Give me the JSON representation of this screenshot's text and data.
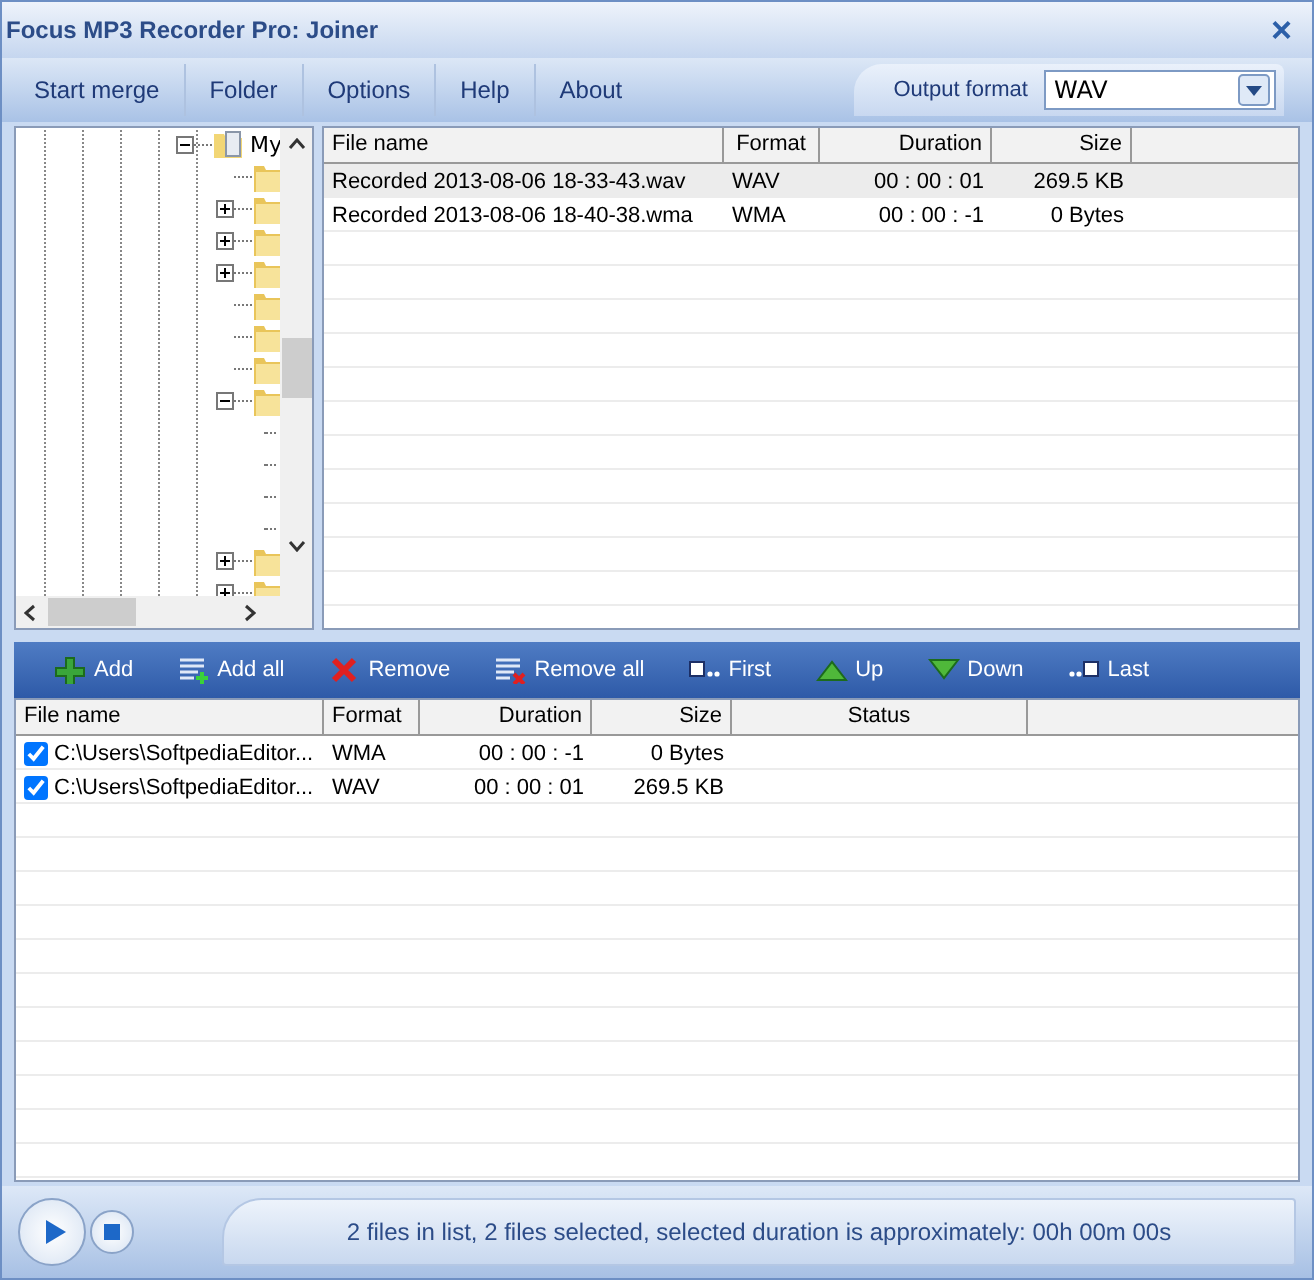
{
  "window": {
    "title": "Focus MP3 Recorder Pro: Joiner",
    "close": "×"
  },
  "menu": [
    {
      "label": "Start merge"
    },
    {
      "label": "Folder"
    },
    {
      "label": "Options"
    },
    {
      "label": "Help"
    },
    {
      "label": "About"
    }
  ],
  "output_format": {
    "label": "Output format",
    "value": "WAV"
  },
  "tree": {
    "label": "My",
    "expanded": true,
    "children": [
      {
        "kind": "leaf"
      },
      {
        "kind": "folder",
        "expanded": false
      },
      {
        "kind": "folder",
        "expanded": false
      },
      {
        "kind": "folder",
        "expanded": false
      },
      {
        "kind": "leaf"
      },
      {
        "kind": "leaf"
      },
      {
        "kind": "leaf"
      },
      {
        "kind": "folder",
        "expanded": true,
        "children": [
          {
            "kind": "stub"
          },
          {
            "kind": "stub"
          },
          {
            "kind": "stub"
          },
          {
            "kind": "stub"
          }
        ]
      },
      {
        "kind": "folder",
        "expanded": false
      },
      {
        "kind": "folder",
        "expanded": false
      }
    ]
  },
  "source_table": {
    "columns": [
      "File name",
      "Format",
      "Duration",
      "Size"
    ],
    "rows": [
      {
        "selected": true,
        "cells": [
          "Recorded 2013-08-06 18-33-43.wav",
          "WAV",
          "00 : 00 : 01",
          "269.5 KB"
        ]
      },
      {
        "selected": false,
        "cells": [
          "Recorded 2013-08-06 18-40-38.wma",
          "WMA",
          "00 : 00 : -1",
          "0 Bytes"
        ]
      }
    ]
  },
  "toolbar": [
    {
      "kind": "add",
      "label": "Add"
    },
    {
      "kind": "add_all",
      "label": "Add all"
    },
    {
      "kind": "remove",
      "label": "Remove"
    },
    {
      "kind": "remove_all",
      "label": "Remove all"
    },
    {
      "kind": "first",
      "label": "First"
    },
    {
      "kind": "up",
      "label": "Up"
    },
    {
      "kind": "down",
      "label": "Down"
    },
    {
      "kind": "last",
      "label": "Last"
    }
  ],
  "join_table": {
    "columns": [
      "File name",
      "Format",
      "Duration",
      "Size",
      "Status"
    ],
    "rows": [
      {
        "checked": true,
        "cells": [
          "C:\\Users\\SoftpediaEditor...",
          "WMA",
          "00 : 00 : -1",
          "0 Bytes",
          ""
        ]
      },
      {
        "checked": true,
        "cells": [
          "C:\\Users\\SoftpediaEditor...",
          "WAV",
          "00 : 00 : 01",
          "269.5 KB",
          ""
        ]
      }
    ]
  },
  "status_bar": {
    "text": "2 files in list, 2 files selected, selected duration is approximately: 00h 00m 00s"
  }
}
